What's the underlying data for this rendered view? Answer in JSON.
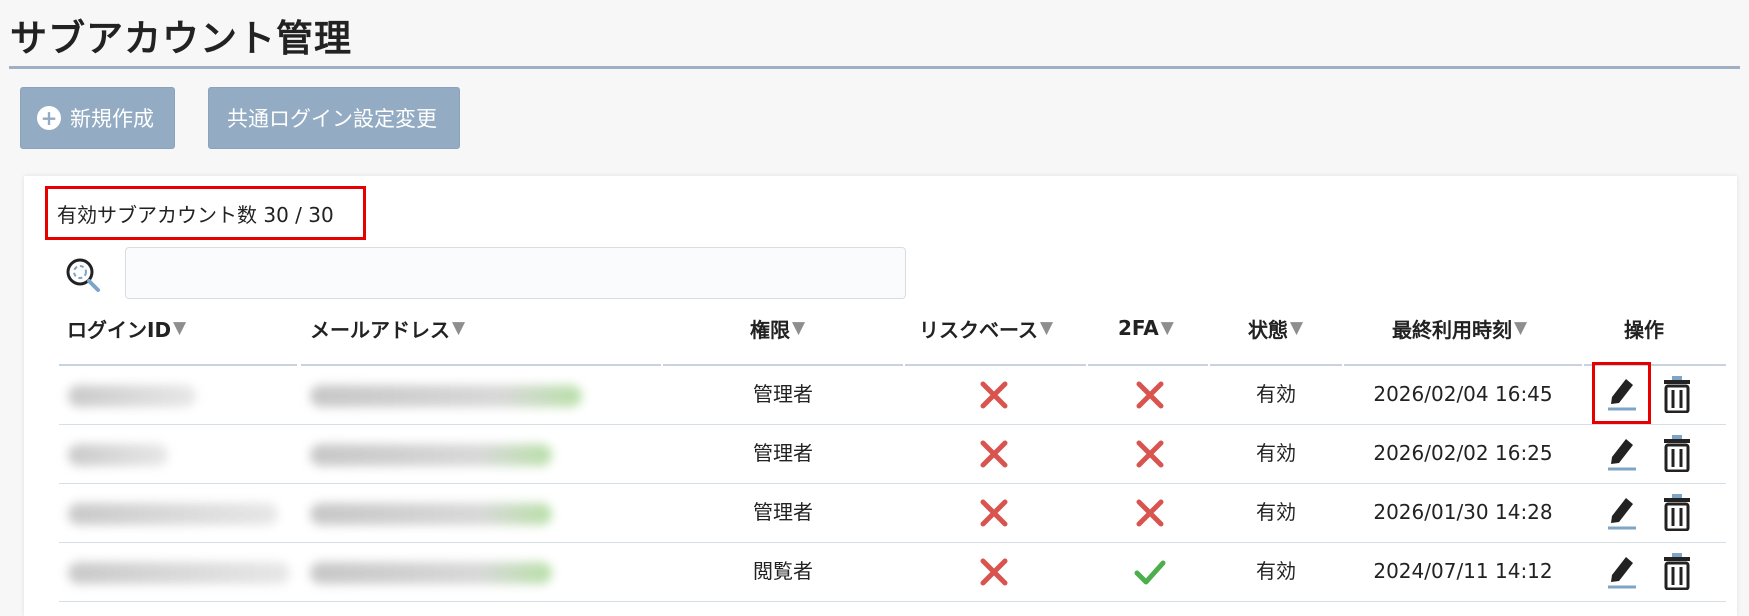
{
  "page": {
    "title": "サブアカウント管理"
  },
  "toolbar": {
    "new_label": "新規作成",
    "common_login_label": "共通ログイン設定変更"
  },
  "summary": {
    "active_count_text": "有効サブアカウント数 30 / 30"
  },
  "search": {
    "value": "",
    "placeholder": ""
  },
  "table": {
    "columns": [
      "ログインID",
      "メールアドレス",
      "権限",
      "リスクベース",
      "2FA",
      "状態",
      "最終利用時刻",
      "操作"
    ],
    "rows": [
      {
        "role": "管理者",
        "risk_based": false,
        "two_fa": false,
        "status": "有効",
        "last_used": "2026/02/04 16:45"
      },
      {
        "role": "管理者",
        "risk_based": false,
        "two_fa": false,
        "status": "有効",
        "last_used": "2026/02/02 16:25"
      },
      {
        "role": "管理者",
        "risk_based": false,
        "two_fa": false,
        "status": "有効",
        "last_used": "2026/01/30 14:28"
      },
      {
        "role": "閲覧者",
        "risk_based": false,
        "two_fa": true,
        "status": "有効",
        "last_used": "2024/07/11 14:12"
      }
    ]
  },
  "icons": {
    "sort": "sort-down-icon",
    "search": "search-icon",
    "new": "plus-circle-icon",
    "edit": "edit-pencil-icon",
    "delete": "trash-icon",
    "disabled": "x-icon",
    "enabled": "check-icon"
  },
  "colors": {
    "button_bg": "#93abc3",
    "highlight_border": "#e60000",
    "x_icon": "#d9534f",
    "check_icon": "#4cae4c",
    "edit_underline": "#7ea4c6"
  }
}
